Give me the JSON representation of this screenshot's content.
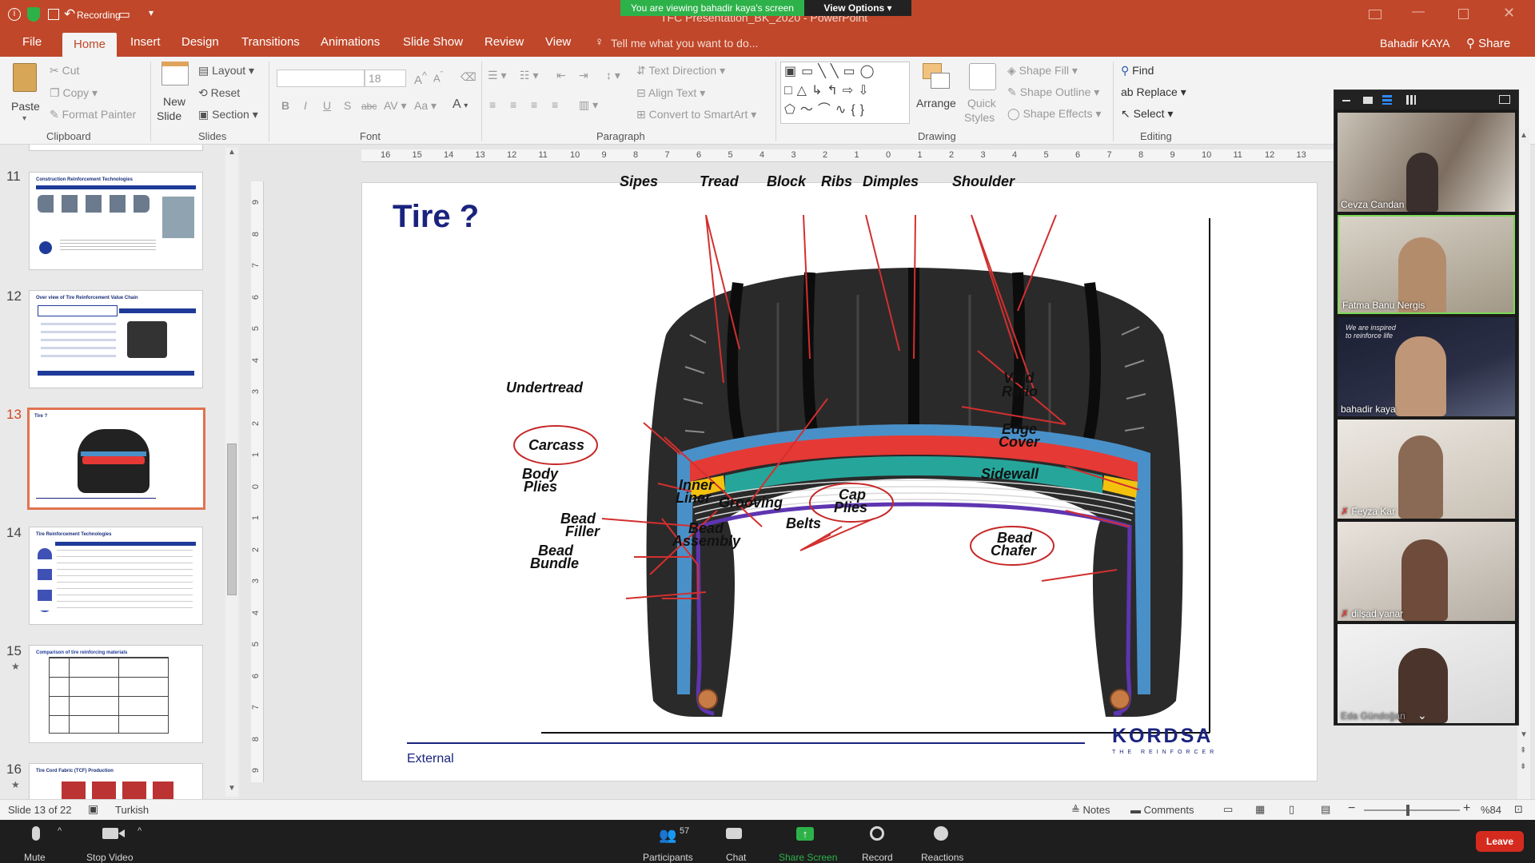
{
  "titlebar": {
    "recording": "Recording",
    "doc_title": "TFC Presentation_BK_2020 - PowerPoint",
    "zoom_banner": "You are viewing bahadir kaya's screen",
    "view_options": "View Options"
  },
  "tabs": [
    "File",
    "Home",
    "Insert",
    "Design",
    "Transitions",
    "Animations",
    "Slide Show",
    "Review",
    "View"
  ],
  "tell_me": "Tell me what you want to do...",
  "user": "Bahadir KAYA",
  "share": "Share",
  "ribbon": {
    "clipboard": {
      "paste": "Paste",
      "cut": "Cut",
      "copy": "Copy",
      "format_painter": "Format Painter",
      "label": "Clipboard"
    },
    "slides": {
      "new_slide_1": "New",
      "new_slide_2": "Slide",
      "layout": "Layout",
      "reset": "Reset",
      "section": "Section",
      "label": "Slides"
    },
    "font": {
      "font_size": "18",
      "label": "Font",
      "bold": "B",
      "italic": "I",
      "underline": "U",
      "shadow": "S",
      "strike": "abc"
    },
    "paragraph": {
      "text_direction": "Text Direction",
      "align_text": "Align Text",
      "convert_smartart": "Convert to SmartArt",
      "label": "Paragraph"
    },
    "drawing": {
      "arrange": "Arrange",
      "quick_styles_1": "Quick",
      "quick_styles_2": "Styles",
      "shape_fill": "Shape Fill",
      "shape_outline": "Shape Outline",
      "shape_effects": "Shape Effects",
      "label": "Drawing"
    },
    "editing": {
      "find": "Find",
      "replace": "Replace",
      "select": "Select",
      "label": "Editing"
    }
  },
  "ruler_numbers": [
    "16",
    "15",
    "14",
    "13",
    "12",
    "11",
    "10",
    "9",
    "8",
    "7",
    "6",
    "5",
    "4",
    "3",
    "2",
    "1",
    "0",
    "1",
    "2",
    "3",
    "4",
    "5",
    "6",
    "7",
    "8",
    "9",
    "10",
    "11",
    "12",
    "13"
  ],
  "vruler_numbers": [
    "9",
    "8",
    "7",
    "6",
    "5",
    "4",
    "3",
    "2",
    "1",
    "0",
    "1",
    "2",
    "3",
    "4",
    "5",
    "6",
    "7",
    "8",
    "9"
  ],
  "thumbnails": [
    {
      "num": "11",
      "title": "Construction Reinforcement Technologies",
      "star": ""
    },
    {
      "num": "12",
      "title": "Over view of Tire Reinforcement Value Chain",
      "star": ""
    },
    {
      "num": "13",
      "title": "Tire ?",
      "star": ""
    },
    {
      "num": "14",
      "title": "Tire Reinforcement Technologies",
      "star": ""
    },
    {
      "num": "15",
      "title": "Comparison of tire reinforcing materials",
      "star": "★"
    },
    {
      "num": "16",
      "title": "Tire Cord Fabric (TCF) Production",
      "star": "★"
    }
  ],
  "slide": {
    "title": "Tire ?",
    "footer": "External",
    "logo": "KORDSA",
    "logo_tag": "THE REINFORCER",
    "labels": {
      "sipes": "Sipes",
      "tread": "Tread",
      "block": "Block",
      "ribs": "Ribs",
      "dimples": "Dimples",
      "shoulder": "Shoulder",
      "void1": "Void",
      "void2": "Ratio",
      "undertread": "Undertread",
      "edge1": "Edge",
      "edge2": "Cover",
      "carcass": "Carcass",
      "sidewall": "Sidewall",
      "body1": "Body",
      "body2": "Plies",
      "inner1": "Inner",
      "inner2": "Liner",
      "grooving": "Grooving",
      "cap1": "Cap",
      "cap2": "Plies",
      "belts": "Belts",
      "filler1": "Bead",
      "filler2": "Filler",
      "assembly1": "Bead",
      "assembly2": "Assembly",
      "chafer1": "Bead",
      "chafer2": "Chafer",
      "bundle1": "Bead",
      "bundle2": "Bundle"
    }
  },
  "status": {
    "slide_of": "Slide 13 of 22",
    "language": "Turkish",
    "notes": "Notes",
    "comments": "Comments",
    "zoom": "%84"
  },
  "participants_gallery": [
    "Cevza Candan",
    "Fatma Banu Nergis",
    "bahadir kaya",
    "Feyza Kar",
    "dilşad yanar",
    "Eda Gündoğan"
  ],
  "video_quote": "We are inspired to reinforce life",
  "zoom_controls": {
    "mute": "Mute",
    "stop_video": "Stop Video",
    "participants": "Participants",
    "participants_count": "57",
    "chat": "Chat",
    "share_screen": "Share Screen",
    "record": "Record",
    "reactions": "Reactions",
    "leave": "Leave"
  },
  "colors": {
    "accent": "#c0472a",
    "zoom_green": "#2db24a",
    "leave": "#d52b1e",
    "navy": "#1a237e"
  }
}
